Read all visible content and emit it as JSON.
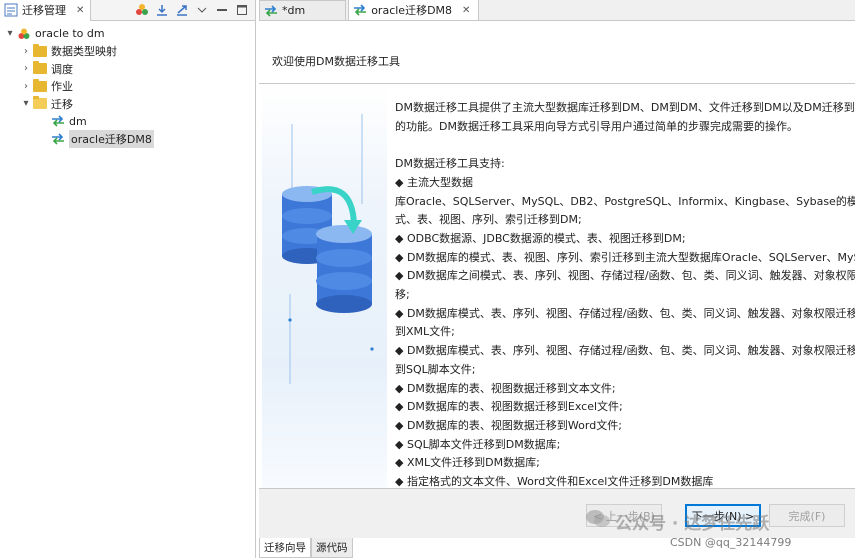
{
  "left": {
    "tab_label": "迁移管理",
    "tab_close": "✕",
    "tree": {
      "root": "oracle  to dm",
      "items": [
        "数据类型映射",
        "调度",
        "作业",
        "迁移"
      ],
      "children": [
        "dm",
        "oracle迁移DM8"
      ]
    }
  },
  "editor": {
    "tabs": [
      "*dm",
      "oracle迁移DM8"
    ],
    "tab_close": "✕"
  },
  "wizard": {
    "title": "欢迎使用DM数据迁移工具",
    "lines": [
      "DM数据迁移工具提供了主流大型数据库迁移到DM、DM到DM、文件迁移到DM以及DM迁移到文件",
      "的功能。DM数据迁移工具采用向导方式引导用户通过简单的步骤完成需要的操作。",
      "DM数据迁移工具支持:",
      "◆ 主流大型数据",
      "库Oracle、SQLServer、MySQL、DB2、PostgreSQL、Informix、Kingbase、Sybase的模",
      "式、表、视图、序列、索引迁移到DM;",
      "◆ ODBC数据源、JDBC数据源的模式、表、视图迁移到DM;",
      "◆ DM数据库的模式、表、视图、序列、索引迁移到主流大型数据库Oracle、SQLServer、MySQL;",
      "◆ DM数据库之间模式、表、序列、视图、存储过程/函数、包、类、同义词、触发器、对象权限的迁",
      "移;",
      "◆ DM数据库模式、表、序列、视图、存储过程/函数、包、类、同义词、触发器、对象权限迁移",
      "到XML文件;",
      "◆ DM数据库模式、表、序列、视图、存储过程/函数、包、类、同义词、触发器、对象权限迁移",
      "到SQL脚本文件;",
      "◆ DM数据库的表、视图数据迁移到文本文件;",
      "◆ DM数据库的表、视图数据迁移到Excel文件;",
      "◆ DM数据库的表、视图数据迁移到Word文件;",
      "◆ SQL脚本文件迁移到DM数据库;",
      "◆ XML文件迁移到DM数据库;",
      "◆ 指定格式的文本文件、Word文件和Excel文件迁移到DM数据库"
    ],
    "buttons": {
      "back": "< 上一步(B)",
      "next": "下一步(N) >",
      "finish": "完成(F)"
    }
  },
  "bottom_tabs": [
    "迁移向导",
    "源代码"
  ],
  "overlay": {
    "watermark": "公众号 · 达梦任先跃",
    "credit": "CSDN @qq_32144799"
  }
}
